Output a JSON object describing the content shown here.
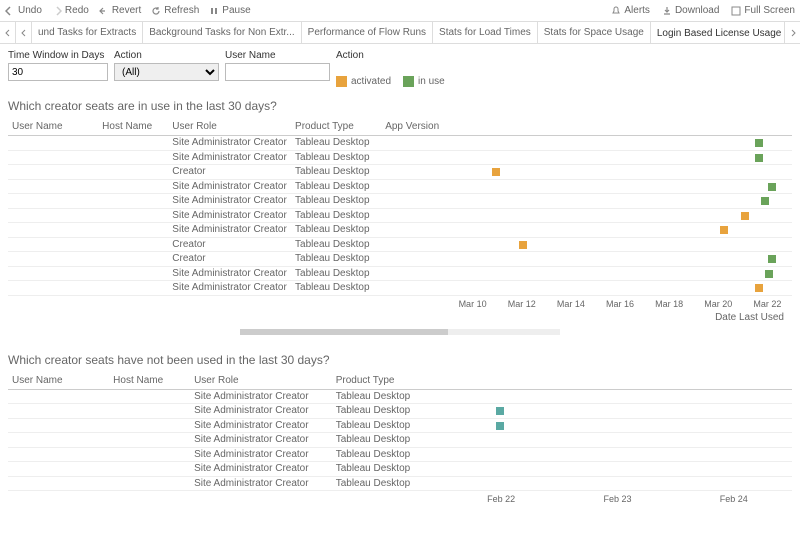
{
  "toolbar": {
    "undo": "Undo",
    "redo": "Redo",
    "revert": "Revert",
    "refresh": "Refresh",
    "pause": "Pause",
    "alerts": "Alerts",
    "download": "Download",
    "fullscreen": "Full Screen"
  },
  "tabs": [
    "und Tasks for Extracts",
    "Background Tasks for Non Extr...",
    "Performance of Flow Runs",
    "Stats for Load Times",
    "Stats for Space Usage",
    "Login Based License Usage"
  ],
  "active_tab_index": 5,
  "filters": {
    "time_window_label": "Time Window in Days",
    "time_window_value": "30",
    "action_label": "Action",
    "action_value": "(All)",
    "user_label": "User Name",
    "user_value": "",
    "legend_label": "Action",
    "legend_activated": "activated",
    "legend_inuse": "in use"
  },
  "section1": {
    "title": "Which creator seats are in use in the last 30 days?",
    "headers": [
      "User Name",
      "Host Name",
      "User Role",
      "Product Type",
      "App Version"
    ],
    "rows": [
      {
        "role": "Site Administrator Creator",
        "product": "Tableau Desktop",
        "pos": 0.89,
        "type": "inuse"
      },
      {
        "role": "Site Administrator Creator",
        "product": "Tableau Desktop",
        "pos": 0.89,
        "type": "inuse"
      },
      {
        "role": "Creator",
        "product": "Tableau Desktop",
        "pos": 0.12,
        "type": "activated"
      },
      {
        "role": "Site Administrator Creator",
        "product": "Tableau Desktop",
        "pos": 0.93,
        "type": "inuse"
      },
      {
        "role": "Site Administrator Creator",
        "product": "Tableau Desktop",
        "pos": 0.91,
        "type": "inuse"
      },
      {
        "role": "Site Administrator Creator",
        "product": "Tableau Desktop",
        "pos": 0.85,
        "type": "activated"
      },
      {
        "role": "Site Administrator Creator",
        "product": "Tableau Desktop",
        "pos": 0.79,
        "type": "activated"
      },
      {
        "role": "Creator",
        "product": "Tableau Desktop",
        "pos": 0.2,
        "type": "activated"
      },
      {
        "role": "Creator",
        "product": "Tableau Desktop",
        "pos": 0.93,
        "type": "inuse"
      },
      {
        "role": "Site Administrator Creator",
        "product": "Tableau Desktop",
        "pos": 0.92,
        "type": "inuse"
      },
      {
        "role": "Site Administrator Creator",
        "product": "Tableau Desktop",
        "pos": 0.89,
        "type": "activated"
      }
    ],
    "axis_ticks": [
      "Mar 10",
      "Mar 12",
      "Mar 14",
      "Mar 16",
      "Mar 18",
      "Mar 20",
      "Mar 22"
    ],
    "axis_label": "Date Last Used"
  },
  "section2": {
    "title": "Which creator seats have not been used in the last 30 days?",
    "headers": [
      "User Name",
      "Host Name",
      "User Role",
      "Product Type"
    ],
    "rows": [
      {
        "role": "Site Administrator Creator",
        "product": "Tableau Desktop",
        "pos": null
      },
      {
        "role": "Site Administrator Creator",
        "product": "Tableau Desktop",
        "pos": 0.14
      },
      {
        "role": "Site Administrator Creator",
        "product": "Tableau Desktop",
        "pos": 0.14
      },
      {
        "role": "Site Administrator Creator",
        "product": "Tableau Desktop",
        "pos": null
      },
      {
        "role": "Site Administrator Creator",
        "product": "Tableau Desktop",
        "pos": null
      },
      {
        "role": "Site Administrator Creator",
        "product": "Tableau Desktop",
        "pos": null
      },
      {
        "role": "Site Administrator Creator",
        "product": "Tableau Desktop",
        "pos": null
      }
    ],
    "axis_ticks": [
      "Feb 22",
      "Feb 23",
      "Feb 24"
    ]
  },
  "chart_data": [
    {
      "type": "scatter",
      "title": "Which creator seats are in use in the last 30 days?",
      "x_axis_label": "Date Last Used",
      "x_categories": [
        "Mar 10",
        "Mar 12",
        "Mar 14",
        "Mar 16",
        "Mar 18",
        "Mar 20",
        "Mar 22"
      ],
      "series": [
        {
          "name": "in use",
          "color": "#6aa35a",
          "points": [
            "Mar 21",
            "Mar 21",
            "Mar 21",
            "Mar 21",
            "Mar 21",
            "Mar 21"
          ]
        },
        {
          "name": "activated",
          "color": "#e8a33d",
          "points": [
            "Mar 11",
            "Mar 20",
            "Mar 19",
            "Mar 12",
            "Mar 21"
          ]
        }
      ]
    },
    {
      "type": "scatter",
      "title": "Which creator seats have not been used in the last 30 days?",
      "x_categories": [
        "Feb 22",
        "Feb 23",
        "Feb 24"
      ],
      "series": [
        {
          "name": "teal",
          "color": "#5aa9a3",
          "points": [
            "Feb 22",
            "Feb 22"
          ]
        }
      ]
    }
  ]
}
